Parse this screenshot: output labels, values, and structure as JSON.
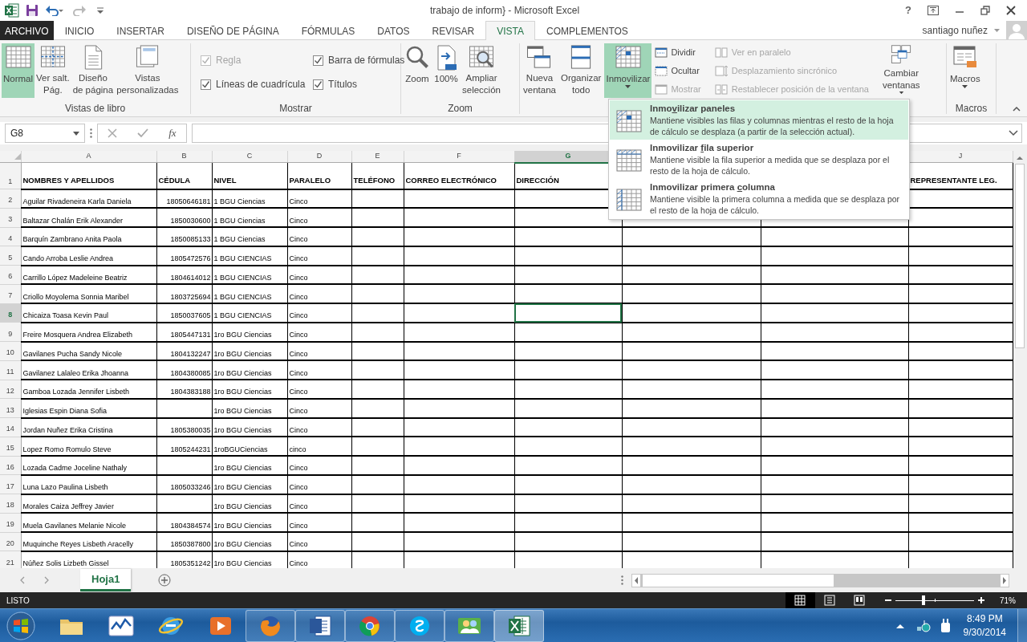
{
  "window": {
    "title": "trabajo de inform} - Microsoft Excel",
    "help": "?"
  },
  "quick_access": {
    "redo": {
      "disabled": true
    }
  },
  "ribbon_tabs": [
    {
      "label": "ARCHIVO",
      "kind": "file",
      "selected": false
    },
    {
      "label": "INICIO",
      "kind": "tab",
      "selected": false
    },
    {
      "label": "INSERTAR",
      "kind": "tab",
      "selected": false
    },
    {
      "label": "DISEÑO DE PÁGINA",
      "kind": "tab",
      "selected": false
    },
    {
      "label": "FÓRMULAS",
      "kind": "tab",
      "selected": false
    },
    {
      "label": "DATOS",
      "kind": "tab",
      "selected": false
    },
    {
      "label": "REVISAR",
      "kind": "tab",
      "selected": false
    },
    {
      "label": "VISTA",
      "kind": "tab",
      "selected": true
    },
    {
      "label": "COMPLEMENTOS",
      "kind": "tab",
      "selected": false
    }
  ],
  "account": {
    "user": "santiago nuñez"
  },
  "ribbon": {
    "groups": [
      {
        "kind": "views",
        "label": "Vistas de libro",
        "buttons": [
          {
            "label": "Normal",
            "selected": true
          },
          {
            "label": "Ver salt.\nPág.",
            "selected": false
          },
          {
            "label": "Diseño\nde página",
            "selected": false
          },
          {
            "label": "Vistas\npersonalizadas",
            "selected": false
          }
        ]
      },
      {
        "kind": "show",
        "label": "Mostrar",
        "checkboxes": [
          {
            "label": "Regla",
            "checked": true,
            "disabled": true
          },
          {
            "label": "Líneas de cuadrícula",
            "checked": true,
            "disabled": false
          },
          {
            "label": "Barra de fórmulas",
            "checked": true,
            "disabled": false
          },
          {
            "label": "Títulos",
            "checked": true,
            "disabled": false
          }
        ]
      },
      {
        "kind": "zoom",
        "label": "Zoom",
        "buttons": [
          {
            "label": "Zoom"
          },
          {
            "label": "100%"
          },
          {
            "label": "Ampliar\nselección"
          }
        ]
      },
      {
        "kind": "window",
        "large_buttons": [
          {
            "label": "Nueva\nventana",
            "expanded": false,
            "dropdown": false
          },
          {
            "label": "Organizar\ntodo",
            "expanded": false,
            "dropdown": false
          },
          {
            "label": "Inmovilizar",
            "expanded": true,
            "dropdown": true
          }
        ],
        "small_buttons": [
          {
            "label": "Dividir",
            "disabled": false
          },
          {
            "label": "Ocultar",
            "disabled": false
          },
          {
            "label": "Mostrar",
            "disabled": true
          }
        ],
        "sync_buttons": [
          {
            "label": "Ver en paralelo",
            "disabled": true
          },
          {
            "label": "Desplazamiento sincrónico",
            "disabled": true
          },
          {
            "label": "Restablecer posición de la ventana",
            "disabled": true
          }
        ],
        "switch_button": {
          "label": "Cambiar\nventanas",
          "dropdown": true
        }
      },
      {
        "kind": "macros",
        "label": "Macros",
        "buttons": [
          {
            "label": "Macros",
            "dropdown": true
          }
        ]
      }
    ]
  },
  "formula_bar": {
    "name_box": "G8",
    "function_label": "fx"
  },
  "sheet": {
    "header_row_number": "1",
    "columns": [
      {
        "letter": "A",
        "heading": "NOMBRES Y APELLIDOS",
        "selected": false
      },
      {
        "letter": "B",
        "heading": "CÉDULA",
        "selected": false
      },
      {
        "letter": "C",
        "heading": "NIVEL",
        "selected": false
      },
      {
        "letter": "D",
        "heading": "PARALELO",
        "selected": false
      },
      {
        "letter": "E",
        "heading": "TELÉFONO",
        "selected": false
      },
      {
        "letter": "F",
        "heading": "CORREO ELECTRÓNICO",
        "selected": false
      },
      {
        "letter": "G",
        "heading": "DIRECCIÓN",
        "selected": true
      },
      {
        "letter": "J",
        "heading": "REPRESENTANTE LEG.",
        "selected": false
      }
    ],
    "rows": [
      {
        "number": "2",
        "name": "Aguilar Rivadeneira Karla Daniela",
        "cedula": "18050646181",
        "nivel": "1 BGU Ciencias",
        "paralelo": "Cinco",
        "selected": false
      },
      {
        "number": "3",
        "name": "Baltazar Chalán Erik Alexander",
        "cedula": "1850030600",
        "nivel": "1 BGU Ciencias",
        "paralelo": "Cinco",
        "selected": false
      },
      {
        "number": "4",
        "name": "Barquín Zambrano Anita Paola",
        "cedula": "1850085133",
        "nivel": "1 BGU Ciencias",
        "paralelo": "Cinco",
        "selected": false
      },
      {
        "number": "5",
        "name": "Cando Arroba Leslie Andrea",
        "cedula": "1805472576",
        "nivel": "1 BGU CIENCIAS",
        "paralelo": "Cinco",
        "selected": false
      },
      {
        "number": "6",
        "name": "Carrillo López Madeleine Beatriz",
        "cedula": "1804614012",
        "nivel": "1 BGU CIENCIAS",
        "paralelo": "Cinco",
        "selected": false
      },
      {
        "number": "7",
        "name": "Criollo Moyolema Sonnia Maribel",
        "cedula": "1803725694",
        "nivel": "1 BGU CIENCIAS",
        "paralelo": "Cinco",
        "selected": false
      },
      {
        "number": "8",
        "name": "Chicaiza Toasa Kevin Paul",
        "cedula": "1850037605",
        "nivel": "1 BGU CIENCIAS",
        "paralelo": "Cinco",
        "selected": true
      },
      {
        "number": "9",
        "name": "Freire Mosquera Andrea Elizabeth",
        "cedula": "1805447131",
        "nivel": "1ro BGU Ciencias",
        "paralelo": "Cinco",
        "selected": false
      },
      {
        "number": "10",
        "name": "Gavilanes Pucha Sandy Nicole",
        "cedula": "1804132247",
        "nivel": "1ro BGU Ciencias",
        "paralelo": "Cinco",
        "selected": false
      },
      {
        "number": "11",
        "name": "Gavilanez Lalaleo Erika Jhoanna",
        "cedula": "1804380085",
        "nivel": "1ro BGU Ciencias",
        "paralelo": "Cinco",
        "selected": false
      },
      {
        "number": "12",
        "name": "Gamboa Lozada Jennifer Lisbeth",
        "cedula": "1804383188",
        "nivel": "1ro BGU Ciencias",
        "paralelo": "Cinco",
        "selected": false
      },
      {
        "number": "13",
        "name": "Iglesias Espin Diana Sofia",
        "nivel": "1ro BGU Ciencias",
        "paralelo": "Cinco",
        "selected": false
      },
      {
        "number": "14",
        "name": "Jordan Nuñez Erika Cristina",
        "cedula": "1805380035",
        "nivel": "1ro BGU Ciencias",
        "paralelo": "Cinco",
        "selected": false
      },
      {
        "number": "15",
        "name": "Lopez Romo Romulo Steve",
        "cedula": "1805244231",
        "nivel": "1roBGUCiencias",
        "paralelo": "cinco",
        "selected": false
      },
      {
        "number": "16",
        "name": "Lozada Cadme Joceline Nathaly",
        "nivel": "1ro BGU Ciencias",
        "paralelo": "Cinco",
        "selected": false
      },
      {
        "number": "17",
        "name": "Luna Lazo Paulina Lisbeth",
        "cedula": "1805033246",
        "nivel": "1ro BGU Ciencias",
        "paralelo": "Cinco",
        "selected": false
      },
      {
        "number": "18",
        "name": "Morales Caiza Jeffrey Javier",
        "nivel": "1ro BGU Ciencias",
        "paralelo": "Cinco",
        "selected": false
      },
      {
        "number": "19",
        "name": "Muela Gavilanes Melanie Nicole",
        "cedula": "1804384574",
        "nivel": "1ro BGU Ciencias",
        "paralelo": "Cinco",
        "selected": false
      },
      {
        "number": "20",
        "name": "Muquinche Reyes Lisbeth Aracelly",
        "cedula": "1850387800",
        "nivel": "1ro BGU Ciencias",
        "paralelo": "Cinco",
        "selected": false
      },
      {
        "number": "21",
        "name": "Núñez Solis Lizbeth Gissel",
        "cedula": "1805351242",
        "nivel": "1ro BGU Ciencias",
        "paralelo": "Cinco",
        "selected": false
      }
    ]
  },
  "freeze_menu": {
    "items": [
      {
        "title_start": "Inmo",
        "access_key": "v",
        "title_end": "ilizar paneles",
        "description": "Mantiene visibles las filas y columnas mientras el resto de la hoja de cálculo se desplaza (a partir de la selección actual).",
        "selected": true
      },
      {
        "title_start": "Inmovilizar ",
        "access_key": "f",
        "title_end": "ila superior",
        "description": "Mantiene visible la fila superior a medida que se desplaza por el resto de la hoja de cálculo.",
        "selected": false
      },
      {
        "title_start": "Inmovilizar primera ",
        "access_key": "c",
        "title_end": "olumna",
        "description": "Mantiene visible la primera columna a medida que se desplaza por el resto de la hoja de cálculo.",
        "selected": false
      }
    ]
  },
  "sheet_tabs": [
    {
      "label": "Hoja1",
      "selected": true
    }
  ],
  "status_bar": {
    "status": "LISTO",
    "views": [
      {
        "selected": true
      },
      {
        "selected": false
      },
      {
        "selected": false
      }
    ],
    "zoom": {
      "level": 0.36,
      "reading": "71%"
    }
  },
  "taskbar": {
    "apps": [
      {
        "running": false,
        "active": false
      },
      {
        "running": false,
        "active": false
      },
      {
        "running": false,
        "active": false
      },
      {
        "running": false,
        "active": false
      },
      {
        "running": true,
        "active": false
      },
      {
        "running": true,
        "active": false
      },
      {
        "running": true,
        "active": false
      },
      {
        "running": true,
        "active": false
      },
      {
        "running": true,
        "active": false
      },
      {
        "running": true,
        "active": true
      }
    ],
    "time": "8:49 PM",
    "date": "9/30/2014"
  }
}
